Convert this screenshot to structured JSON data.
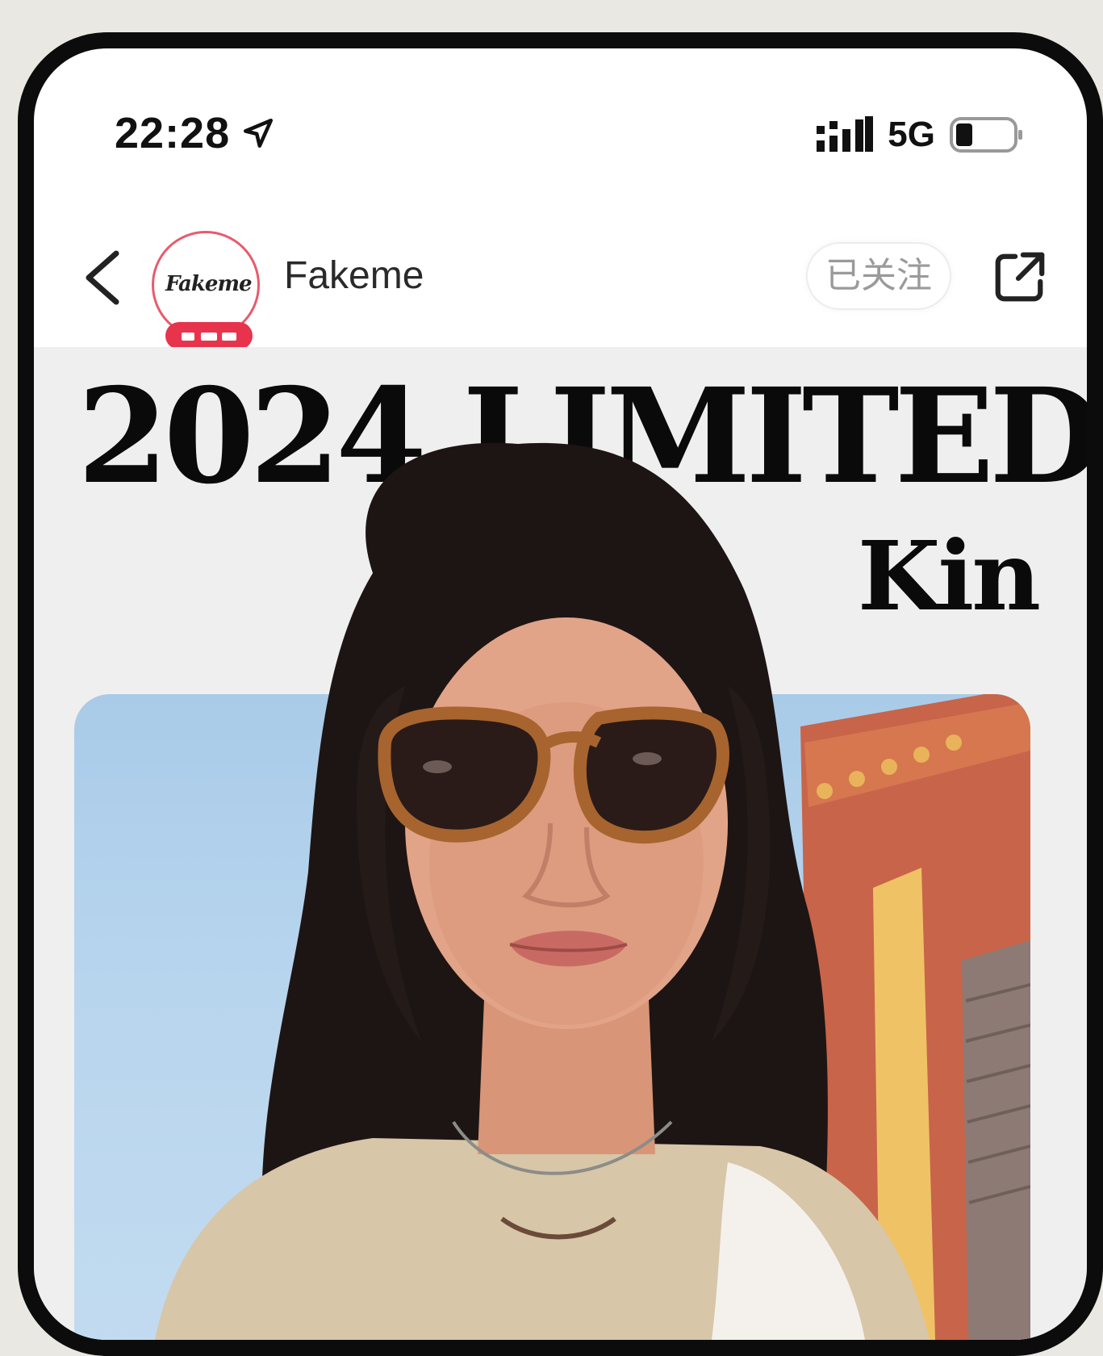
{
  "status_bar": {
    "time": "22:28",
    "network": "5G",
    "icons": [
      "location-arrow-icon",
      "signal-icon",
      "battery-icon"
    ]
  },
  "nav": {
    "back_icon": "chevron-left-icon",
    "account_name": "Fakeme",
    "avatar_logo_text": "Fakeme",
    "follow_label": "已关注",
    "share_icon": "share-external-icon"
  },
  "poster": {
    "headline": "2024 LIMITED",
    "subheadline": "Kin"
  },
  "colors": {
    "badge_red": "#e8334d",
    "avatar_ring": "#e85b6c",
    "sky_blue": "#b8d5ee",
    "building_orange": "#c8644a"
  }
}
